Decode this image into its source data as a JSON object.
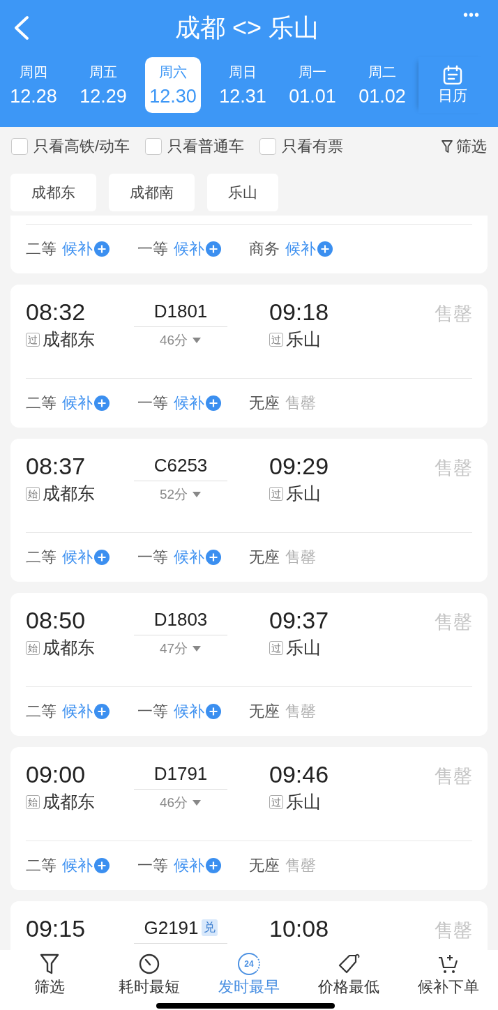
{
  "header": {
    "title": "成都 <> 乐山",
    "more": "•••"
  },
  "dates": [
    {
      "weekday": "周四",
      "date": "12.28",
      "selected": false
    },
    {
      "weekday": "周五",
      "date": "12.29",
      "selected": false
    },
    {
      "weekday": "周六",
      "date": "12.30",
      "selected": true
    },
    {
      "weekday": "周日",
      "date": "12.31",
      "selected": false
    },
    {
      "weekday": "周一",
      "date": "01.01",
      "selected": false
    },
    {
      "weekday": "周二",
      "date": "01.02",
      "selected": false
    }
  ],
  "calendar": {
    "label": "日历"
  },
  "filters": [
    {
      "label": "只看高铁/动车",
      "checked": false
    },
    {
      "label": "只看普通车",
      "checked": false
    },
    {
      "label": "只看有票",
      "checked": false
    }
  ],
  "filter_button": "筛选",
  "stations": [
    "成都东",
    "成都南",
    "乐山"
  ],
  "trains": [
    {
      "seats": [
        {
          "class": "二等",
          "status": "候补",
          "kind": "waitlist"
        },
        {
          "class": "一等",
          "status": "候补",
          "kind": "waitlist"
        },
        {
          "class": "商务",
          "status": "候补",
          "kind": "waitlist"
        }
      ]
    },
    {
      "depart": "08:32",
      "train": "D1801",
      "duration": "46分",
      "arrive": "09:18",
      "from_tag": "过",
      "from": "成都东",
      "to_tag": "过",
      "to": "乐山",
      "availability": "售罄",
      "seats": [
        {
          "class": "二等",
          "status": "候补",
          "kind": "waitlist"
        },
        {
          "class": "一等",
          "status": "候补",
          "kind": "waitlist"
        },
        {
          "class": "无座",
          "status": "售罄",
          "kind": "soldout"
        }
      ]
    },
    {
      "depart": "08:37",
      "train": "C6253",
      "duration": "52分",
      "arrive": "09:29",
      "from_tag": "始",
      "from": "成都东",
      "to_tag": "过",
      "to": "乐山",
      "availability": "售罄",
      "seats": [
        {
          "class": "二等",
          "status": "候补",
          "kind": "waitlist"
        },
        {
          "class": "一等",
          "status": "候补",
          "kind": "waitlist"
        },
        {
          "class": "无座",
          "status": "售罄",
          "kind": "soldout"
        }
      ]
    },
    {
      "depart": "08:50",
      "train": "D1803",
      "duration": "47分",
      "arrive": "09:37",
      "from_tag": "始",
      "from": "成都东",
      "to_tag": "过",
      "to": "乐山",
      "availability": "售罄",
      "seats": [
        {
          "class": "二等",
          "status": "候补",
          "kind": "waitlist"
        },
        {
          "class": "一等",
          "status": "候补",
          "kind": "waitlist"
        },
        {
          "class": "无座",
          "status": "售罄",
          "kind": "soldout"
        }
      ]
    },
    {
      "depart": "09:00",
      "train": "D1791",
      "duration": "46分",
      "arrive": "09:46",
      "from_tag": "始",
      "from": "成都东",
      "to_tag": "过",
      "to": "乐山",
      "availability": "售罄",
      "seats": [
        {
          "class": "二等",
          "status": "候补",
          "kind": "waitlist"
        },
        {
          "class": "一等",
          "status": "候补",
          "kind": "waitlist"
        },
        {
          "class": "无座",
          "status": "售罄",
          "kind": "soldout"
        }
      ]
    },
    {
      "depart": "09:15",
      "train": "G2191",
      "badge": "兑",
      "arrive": "10:08",
      "availability": "售罄"
    }
  ],
  "bottom_bar": [
    {
      "label": "筛选",
      "kind": "filter",
      "selected": false
    },
    {
      "label": "耗时最短",
      "kind": "timer",
      "selected": false
    },
    {
      "label": "发时最早",
      "kind": "clock",
      "icon_text": "24",
      "selected": true
    },
    {
      "label": "价格最低",
      "kind": "tag",
      "selected": false
    },
    {
      "label": "候补下单",
      "kind": "cart",
      "selected": false
    }
  ]
}
